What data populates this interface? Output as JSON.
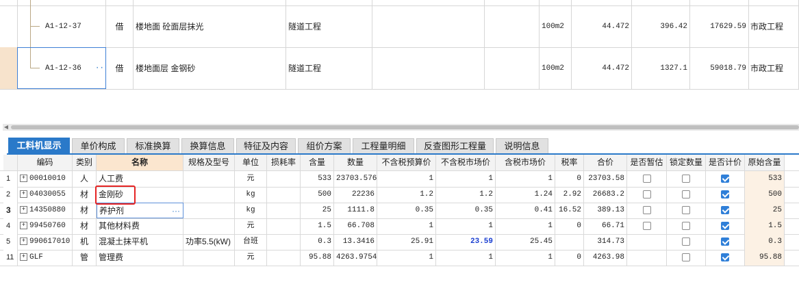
{
  "top_rows": [
    {
      "code": "A1-12-37",
      "type": "借",
      "name": "楼地面 砼面层抹光",
      "category": "隧道工程",
      "unit": "100m2",
      "qty": "44.472",
      "price": "396.42",
      "total": "17629.59",
      "specialty": "市政工程",
      "selected": false
    },
    {
      "code": "A1-12-36",
      "type": "借",
      "name": "楼地面层 金钢砂",
      "category": "隧道工程",
      "unit": "100m2",
      "qty": "44.472",
      "price": "1327.1",
      "total": "59018.79",
      "specialty": "市政工程",
      "selected": true
    }
  ],
  "ellipsis": "···",
  "tabs": [
    "工料机显示",
    "单价构成",
    "标准换算",
    "换算信息",
    "特征及内容",
    "组价方案",
    "工程量明细",
    "反查图形工程量",
    "说明信息"
  ],
  "columns": [
    "编码",
    "类别",
    "名称",
    "规格及型号",
    "单位",
    "损耗率",
    "含量",
    "数量",
    "不含税预算价",
    "不含税市场价",
    "含税市场价",
    "税率",
    "合价",
    "是否暂估",
    "锁定数量",
    "是否计价",
    "原始含量"
  ],
  "rows": [
    {
      "no": "1",
      "code": "00010010",
      "kind": "人",
      "name": "人工费",
      "spec": "",
      "unit": "元",
      "loss": "",
      "content": "533",
      "amount": "23703.576",
      "budget": "1",
      "market": "1",
      "market_tax": "1",
      "tax": "0",
      "sum": "23703.58",
      "est": false,
      "lock": false,
      "priced": true,
      "orig": "533"
    },
    {
      "no": "2",
      "code": "04030055",
      "kind": "材",
      "name": "金刚砂",
      "spec": "",
      "unit": "kg",
      "loss": "",
      "content": "500",
      "amount": "22236",
      "budget": "1.2",
      "market": "1.2",
      "market_tax": "1.24",
      "tax": "2.92",
      "sum": "26683.2",
      "est": false,
      "lock": false,
      "priced": true,
      "orig": "500"
    },
    {
      "no": "3",
      "code": "14350880",
      "kind": "材",
      "name": "养护剂",
      "spec": "",
      "unit": "kg",
      "loss": "",
      "content": "25",
      "amount": "1111.8",
      "budget": "0.35",
      "market": "0.35",
      "market_tax": "0.41",
      "tax": "16.52",
      "sum": "389.13",
      "est": false,
      "lock": false,
      "priced": true,
      "orig": "25"
    },
    {
      "no": "4",
      "code": "99450760",
      "kind": "材",
      "name": "其他材料费",
      "spec": "",
      "unit": "元",
      "loss": "",
      "content": "1.5",
      "amount": "66.708",
      "budget": "1",
      "market": "1",
      "market_tax": "1",
      "tax": "0",
      "sum": "66.71",
      "est": false,
      "lock": false,
      "priced": true,
      "orig": "1.5"
    },
    {
      "no": "5",
      "code": "990617010",
      "kind": "机",
      "name": "混凝土抹平机",
      "spec": "功率5.5(kW)",
      "unit": "台班",
      "loss": "",
      "content": "0.3",
      "amount": "13.3416",
      "budget": "25.91",
      "market": "23.59",
      "market_tax": "25.45",
      "tax": "",
      "sum": "314.73",
      "est": null,
      "lock": false,
      "priced": true,
      "orig": "0.3"
    },
    {
      "no": "11",
      "code": "GLF",
      "kind": "管",
      "name": "管理费",
      "spec": "",
      "unit": "元",
      "loss": "",
      "content": "95.88",
      "amount": "4263.9754",
      "budget": "1",
      "market": "1",
      "market_tax": "1",
      "tax": "0",
      "sum": "4263.98",
      "est": null,
      "lock": false,
      "priced": true,
      "orig": "95.88"
    }
  ],
  "colors": {
    "accent": "#2a79c9",
    "highlight": "#e52323",
    "market_changed": "#1a3fd1"
  }
}
